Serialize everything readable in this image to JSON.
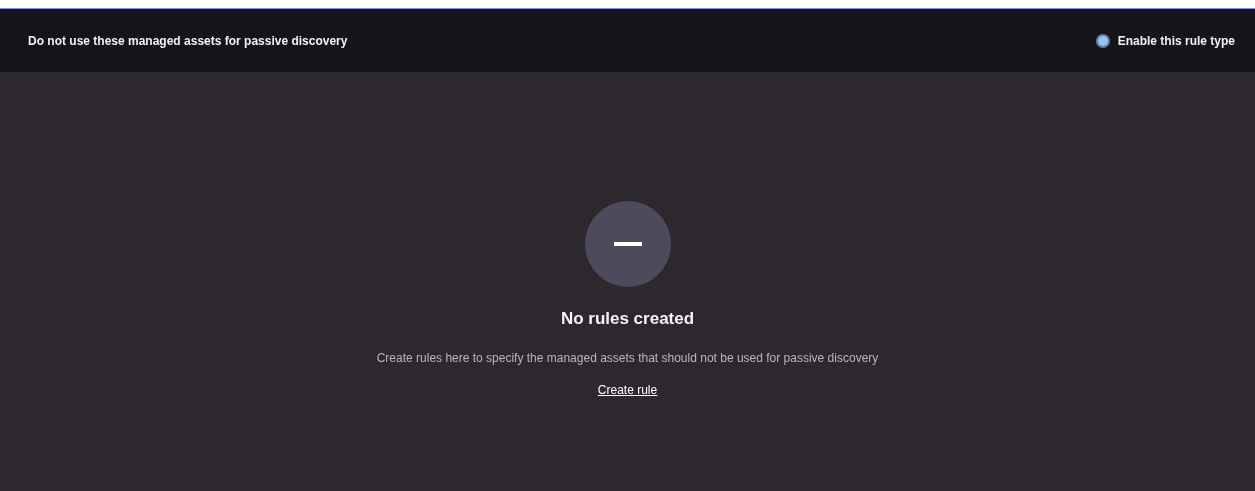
{
  "header": {
    "title": "Do not use these managed assets for passive discovery",
    "toggle": {
      "label": "Enable this rule type",
      "checked": true
    }
  },
  "empty_state": {
    "title": "No rules created",
    "description": "Create rules here to specify the managed assets that should not be used for passive discovery",
    "link": "Create rule"
  }
}
